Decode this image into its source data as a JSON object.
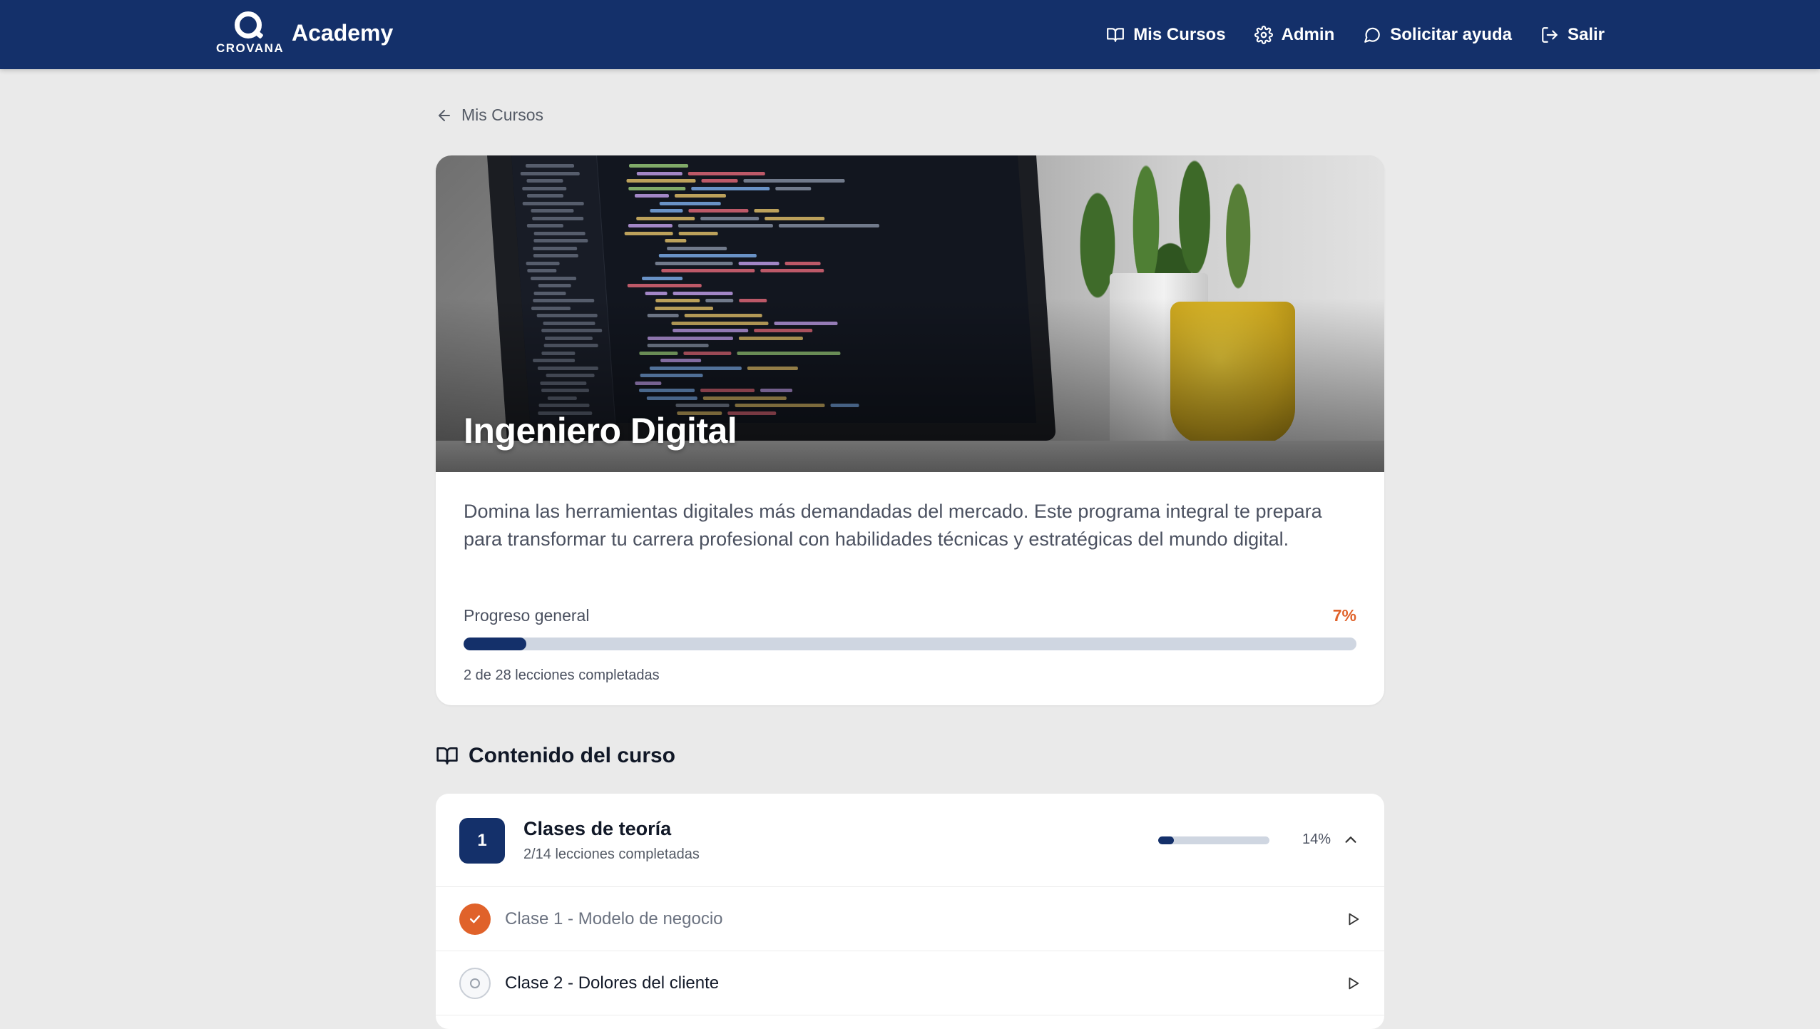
{
  "header": {
    "logo_text": "CROVANA",
    "title": "Academy",
    "nav": [
      {
        "label": "Mis Cursos",
        "icon": "book-icon"
      },
      {
        "label": "Admin",
        "icon": "gear-icon"
      },
      {
        "label": "Solicitar ayuda",
        "icon": "chat-icon"
      },
      {
        "label": "Salir",
        "icon": "logout-icon"
      }
    ]
  },
  "back": {
    "label": "Mis Cursos"
  },
  "course": {
    "title": "Ingeniero Digital",
    "description": "Domina las herramientas digitales más demandadas del mercado. Este programa integral te prepara para transformar tu carrera profesional con habilidades técnicas y estratégicas del mundo digital.",
    "progress_label": "Progreso general",
    "progress_value": 7,
    "progress_text": "7%",
    "progress_count": "2 de 28 lecciones completadas"
  },
  "content": {
    "section_title": "Contenido del curso",
    "modules": [
      {
        "number": "1",
        "title": "Clases de teoría",
        "subtitle": "2/14 lecciones completadas",
        "progress_value": 14,
        "progress_text": "14%",
        "expanded": true,
        "lessons": [
          {
            "title": "Clase 1 - Modelo de negocio",
            "completed": true
          },
          {
            "title": "Clase 2 - Dolores del cliente",
            "completed": false
          }
        ]
      }
    ]
  },
  "colors": {
    "primary": "#14306a",
    "accent": "#e0622a",
    "background": "#eaeaea"
  }
}
